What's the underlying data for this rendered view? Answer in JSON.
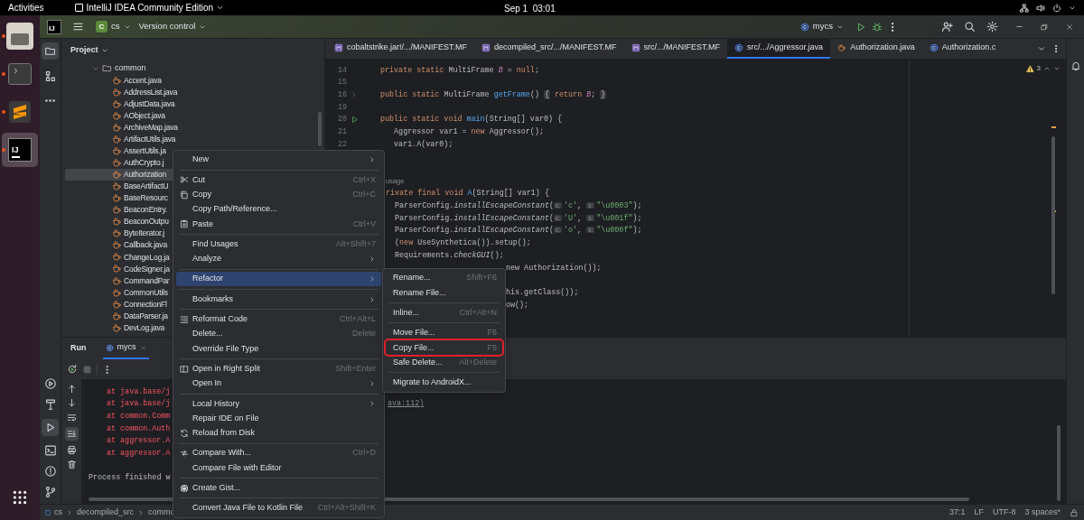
{
  "system_bar": {
    "activities": "Activities",
    "app_menu": "IntelliJ IDEA Community Edition",
    "clock": "Sep 1  03:01"
  },
  "dock": {
    "apps": [
      {
        "running": true,
        "selected": false
      },
      {
        "running": true,
        "selected": false
      },
      {
        "running": true,
        "selected": false
      },
      {
        "running": true,
        "selected": true,
        "label": "IJ"
      }
    ]
  },
  "toolbar": {
    "logo": "IJ",
    "project_badge": "C",
    "project": "cs",
    "vcs": "Version control",
    "run_config": "mycs"
  },
  "editor_tabs": [
    {
      "label": "cobaltstrike.jar!/.../MANIFEST.MF",
      "kind": "manifest",
      "selected": false
    },
    {
      "label": "decompiled_src/.../MANIFEST.MF",
      "kind": "manifest",
      "selected": false
    },
    {
      "label": "src/.../MANIFEST.MF",
      "kind": "manifest",
      "selected": false
    },
    {
      "label": "src/.../Aggressor.java",
      "kind": "class",
      "selected": true
    },
    {
      "label": "Authorization.java",
      "kind": "java",
      "selected": false
    },
    {
      "label": "Authorization.c",
      "kind": "class",
      "selected": false
    }
  ],
  "project_panel": {
    "title": "Project",
    "folder": "common",
    "files": [
      {
        "name": "Accent.java",
        "selected": false
      },
      {
        "name": "AddressList.java",
        "selected": false
      },
      {
        "name": "AdjustData.java",
        "selected": false
      },
      {
        "name": "AObject.java",
        "selected": false
      },
      {
        "name": "ArchiveMap.java",
        "selected": false
      },
      {
        "name": "ArtifactUtils.java",
        "selected": false
      },
      {
        "name": "AssertUtils.ja",
        "selected": false
      },
      {
        "name": "AuthCrypto.j",
        "selected": false
      },
      {
        "name": "Authorization",
        "selected": true
      },
      {
        "name": "BaseArtifactU",
        "selected": false
      },
      {
        "name": "BaseResourc",
        "selected": false
      },
      {
        "name": "BeaconEntry.",
        "selected": false
      },
      {
        "name": "BeaconOutpu",
        "selected": false
      },
      {
        "name": "ByteIterator.j",
        "selected": false
      },
      {
        "name": "Callback.java",
        "selected": false
      },
      {
        "name": "ChangeLog.ja",
        "selected": false
      },
      {
        "name": "CodeSigner.ja",
        "selected": false
      },
      {
        "name": "CommandPar",
        "selected": false
      },
      {
        "name": "CommonUtils",
        "selected": false
      },
      {
        "name": "ConnectionFl",
        "selected": false
      },
      {
        "name": "DataParser.ja",
        "selected": false
      },
      {
        "name": "DevLog.java",
        "selected": false
      }
    ]
  },
  "editor": {
    "inspections": "3",
    "lines": [
      {
        "number": "14",
        "kind": "code",
        "foldable": false,
        "runnable": false,
        "tokens": [
          {
            "kind": "kw",
            "text": "private static "
          },
          {
            "kind": "plain",
            "text": "MultiFrame "
          },
          {
            "kind": "field",
            "text": "B"
          },
          {
            "kind": "plain",
            "text": " = "
          },
          {
            "kind": "kw",
            "text": "null"
          },
          {
            "kind": "plain",
            "text": ";"
          }
        ]
      },
      {
        "number": "15",
        "kind": "code",
        "foldable": false,
        "runnable": false
      },
      {
        "number": "16",
        "kind": "code",
        "foldable": true,
        "runnable": false,
        "tokens": [
          {
            "kind": "kw",
            "text": "public static "
          },
          {
            "kind": "plain",
            "text": "MultiFrame "
          },
          {
            "kind": "fn",
            "text": "getFrame"
          },
          {
            "kind": "plain",
            "text": "() "
          },
          {
            "kind": "fold",
            "text": "{"
          },
          {
            "kind": "kw",
            "text": " return "
          },
          {
            "kind": "field",
            "text": "B"
          },
          {
            "kind": "plain",
            "text": "; "
          },
          {
            "kind": "fold",
            "text": "}"
          }
        ]
      },
      {
        "number": "19",
        "kind": "code",
        "foldable": false,
        "runnable": false
      },
      {
        "number": "20",
        "kind": "code",
        "foldable": false,
        "runnable": true,
        "tokens": [
          {
            "kind": "kw",
            "text": "public static void "
          },
          {
            "kind": "fn",
            "text": "main"
          },
          {
            "kind": "plain",
            "text": "(String[] var0) {"
          }
        ]
      },
      {
        "number": "21",
        "kind": "code",
        "foldable": false,
        "runnable": false,
        "tokens": [
          {
            "kind": "plain",
            "text": "   Aggressor var1 = "
          },
          {
            "kind": "kw",
            "text": "new "
          },
          {
            "kind": "plain",
            "text": "Aggressor();"
          }
        ]
      },
      {
        "number": "22",
        "kind": "code",
        "foldable": false,
        "runnable": false,
        "tokens": [
          {
            "kind": "plain",
            "text": "   var1.A(var0);"
          }
        ]
      },
      {
        "kind": "code"
      },
      {
        "kind": "code"
      },
      {
        "kind": "edge",
        "tokens": [
          {
            "kind": "inlay",
            "text": "usage"
          }
        ]
      },
      {
        "kind": "edge",
        "tokens": [
          {
            "kind": "kw",
            "text": "rivate final void "
          },
          {
            "kind": "fn",
            "text": "A"
          },
          {
            "kind": "plain",
            "text": "(String[] var1) {"
          }
        ]
      },
      {
        "kind": "edge",
        "tokens": [
          {
            "kind": "plain",
            "text": "  ParserConfig."
          },
          {
            "kind": "italic",
            "text": "installEscapeConstant"
          },
          {
            "kind": "plain",
            "text": "("
          },
          {
            "kind": "hint",
            "text": "c:"
          },
          {
            "kind": "str",
            "text": "'c'"
          },
          {
            "kind": "plain",
            "text": ", "
          },
          {
            "kind": "hint",
            "text": "s:"
          },
          {
            "kind": "str",
            "text": "\"\\u0003\""
          },
          {
            "kind": "plain",
            "text": ");"
          }
        ]
      },
      {
        "kind": "edge",
        "tokens": [
          {
            "kind": "plain",
            "text": "  ParserConfig."
          },
          {
            "kind": "italic",
            "text": "installEscapeConstant"
          },
          {
            "kind": "plain",
            "text": "("
          },
          {
            "kind": "hint",
            "text": "c:"
          },
          {
            "kind": "str",
            "text": "'U'"
          },
          {
            "kind": "plain",
            "text": ", "
          },
          {
            "kind": "hint",
            "text": "s:"
          },
          {
            "kind": "str",
            "text": "\"\\u001f\""
          },
          {
            "kind": "plain",
            "text": ");"
          }
        ]
      },
      {
        "kind": "edge",
        "tokens": [
          {
            "kind": "plain",
            "text": "  ParserConfig."
          },
          {
            "kind": "italic",
            "text": "installEscapeConstant"
          },
          {
            "kind": "plain",
            "text": "("
          },
          {
            "kind": "hint",
            "text": "c:"
          },
          {
            "kind": "str",
            "text": "'o'"
          },
          {
            "kind": "plain",
            "text": ", "
          },
          {
            "kind": "hint",
            "text": "s:"
          },
          {
            "kind": "str",
            "text": "\"\\u000f\""
          },
          {
            "kind": "plain",
            "text": ");"
          }
        ]
      },
      {
        "kind": "edge",
        "tokens": [
          {
            "kind": "plain",
            "text": "  ("
          },
          {
            "kind": "kw",
            "text": "new "
          },
          {
            "kind": "plain",
            "text": "UseSynthetica()).setup();"
          }
        ]
      },
      {
        "kind": "edge",
        "tokens": [
          {
            "kind": "plain",
            "text": "  Requirements."
          },
          {
            "kind": "italic",
            "text": "checkGUI"
          },
          {
            "kind": "plain",
            "text": "();"
          }
        ]
      },
      {
        "kind": "after-menu",
        "tokens": [
          {
            "kind": "plain",
            "text": "new "
          },
          {
            "kind": "plain",
            "text": "Authorization());"
          }
        ]
      },
      {
        "kind": "code"
      },
      {
        "kind": "after-menu",
        "tokens": [
          {
            "kind": "plain",
            "text": "his.getClass());"
          }
        ]
      },
      {
        "kind": "after-menu",
        "tokens": [
          {
            "kind": "plain",
            "text": "ow();"
          }
        ]
      }
    ]
  },
  "run_panel": {
    "title": "Run",
    "tab": {
      "label": "mycs",
      "selected": true
    },
    "console": [
      {
        "kind": "error",
        "text": "at java.base/j"
      },
      {
        "kind": "error",
        "text": "at java.base/j",
        "tail": "ava:112)"
      },
      {
        "kind": "error",
        "text": "at common.Comm"
      },
      {
        "kind": "error",
        "text": "at common.Auth"
      },
      {
        "kind": "error",
        "text": "at aggressor.A"
      },
      {
        "kind": "error",
        "text": "at aggressor.A"
      },
      {
        "kind": "blank"
      },
      {
        "kind": "info",
        "text": "Process finished w"
      }
    ]
  },
  "context_menu": {
    "items": [
      {
        "kind": "item",
        "label": "New",
        "submenu": true,
        "selected": false
      },
      {
        "kind": "separator"
      },
      {
        "kind": "item",
        "label": "Cut",
        "shortcut": "Ctrl+X",
        "submenu": false,
        "selected": false
      },
      {
        "kind": "item",
        "label": "Copy",
        "shortcut": "Ctrl+C",
        "submenu": false,
        "selected": false
      },
      {
        "kind": "item",
        "label": "Copy Path/Reference...",
        "submenu": false,
        "selected": false
      },
      {
        "kind": "item",
        "label": "Paste",
        "shortcut": "Ctrl+V",
        "submenu": false,
        "selected": false
      },
      {
        "kind": "separator"
      },
      {
        "kind": "item",
        "label": "Find Usages",
        "shortcut": "Alt+Shift+7",
        "submenu": false,
        "selected": false
      },
      {
        "kind": "item",
        "label": "Analyze",
        "submenu": true,
        "selected": false
      },
      {
        "kind": "separator"
      },
      {
        "kind": "item",
        "label": "Refactor",
        "submenu": true,
        "selected": true
      },
      {
        "kind": "separator"
      },
      {
        "kind": "item",
        "label": "Bookmarks",
        "submenu": true,
        "selected": false
      },
      {
        "kind": "separator"
      },
      {
        "kind": "item",
        "label": "Reformat Code",
        "shortcut": "Ctrl+Alt+L",
        "submenu": false,
        "selected": false
      },
      {
        "kind": "item",
        "label": "Delete...",
        "shortcut": "Delete",
        "submenu": false,
        "selected": false
      },
      {
        "kind": "item",
        "label": "Override File Type",
        "submenu": false,
        "selected": false
      },
      {
        "kind": "separator"
      },
      {
        "kind": "item",
        "label": "Open in Right Split",
        "shortcut": "Shift+Enter",
        "submenu": false,
        "selected": false
      },
      {
        "kind": "item",
        "label": "Open In",
        "submenu": true,
        "selected": false
      },
      {
        "kind": "separator"
      },
      {
        "kind": "item",
        "label": "Local History",
        "submenu": true,
        "selected": false
      },
      {
        "kind": "item",
        "label": "Repair IDE on File",
        "submenu": false,
        "selected": false
      },
      {
        "kind": "item",
        "label": "Reload from Disk",
        "submenu": false,
        "selected": false
      },
      {
        "kind": "separator"
      },
      {
        "kind": "item",
        "label": "Compare With...",
        "shortcut": "Ctrl+D",
        "submenu": false,
        "selected": false
      },
      {
        "kind": "item",
        "label": "Compare File with Editor",
        "submenu": false,
        "selected": false
      },
      {
        "kind": "separator"
      },
      {
        "kind": "item",
        "label": "Create Gist...",
        "submenu": false,
        "selected": false
      },
      {
        "kind": "separator"
      },
      {
        "kind": "item",
        "label": "Convert Java File to Kotlin File",
        "shortcut": "Ctrl+Alt+Shift+K",
        "submenu": false,
        "selected": false
      }
    ]
  },
  "refactor_submenu": {
    "items": [
      {
        "kind": "item",
        "label": "Rename...",
        "shortcut": "Shift+F6",
        "highlighted": false
      },
      {
        "kind": "item",
        "label": "Rename File...",
        "highlighted": false
      },
      {
        "kind": "separator"
      },
      {
        "kind": "item",
        "label": "Inline...",
        "shortcut": "Ctrl+Alt+N",
        "highlighted": false
      },
      {
        "kind": "separator"
      },
      {
        "kind": "item",
        "label": "Move File...",
        "shortcut": "F6",
        "highlighted": false
      },
      {
        "kind": "item",
        "label": "Copy File...",
        "shortcut": "F5",
        "highlighted": true
      },
      {
        "kind": "item",
        "label": "Safe Delete...",
        "shortcut": "Alt+Delete",
        "highlighted": false
      },
      {
        "kind": "separator"
      },
      {
        "kind": "item",
        "label": "Migrate to AndroidX...",
        "highlighted": false
      }
    ]
  },
  "status_bar": {
    "breadcrumbs": [
      "cs",
      "decompiled_src",
      "commo"
    ],
    "position": "37:1",
    "line_separator": "LF",
    "encoding": "UTF-8",
    "indent": "3 spaces*"
  }
}
